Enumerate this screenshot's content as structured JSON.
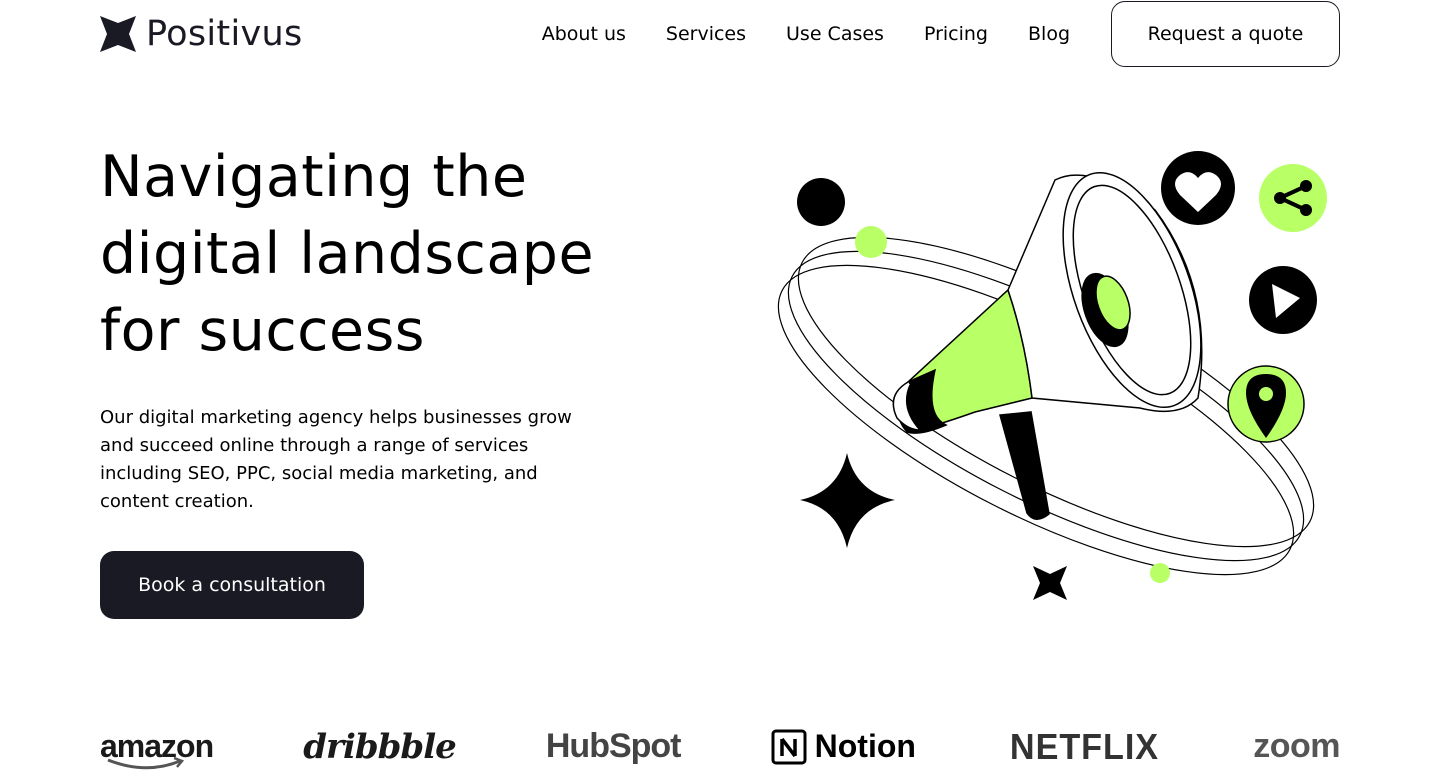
{
  "header": {
    "logo_text": "Positivus",
    "nav": [
      "About us",
      "Services",
      "Use Cases",
      "Pricing",
      "Blog"
    ],
    "cta_label": "Request a quote"
  },
  "hero": {
    "title": "Navigating the digital landscape for success",
    "description": "Our digital marketing agency helps businesses grow and succeed online through a range of services including SEO, PPC, social media marketing, and content creation.",
    "button_label": "Book a consultation",
    "accent_color": "#B9FF66",
    "dark_color": "#191A23"
  },
  "illustration": {
    "icons": [
      "heart-icon",
      "share-icon",
      "play-icon",
      "location-pin-icon",
      "megaphone-icon",
      "sparkle-star-icon"
    ]
  },
  "client_logos": [
    "amazon",
    "dribbble",
    "HubSpot",
    "Notion",
    "NETFLIX",
    "zoom"
  ]
}
